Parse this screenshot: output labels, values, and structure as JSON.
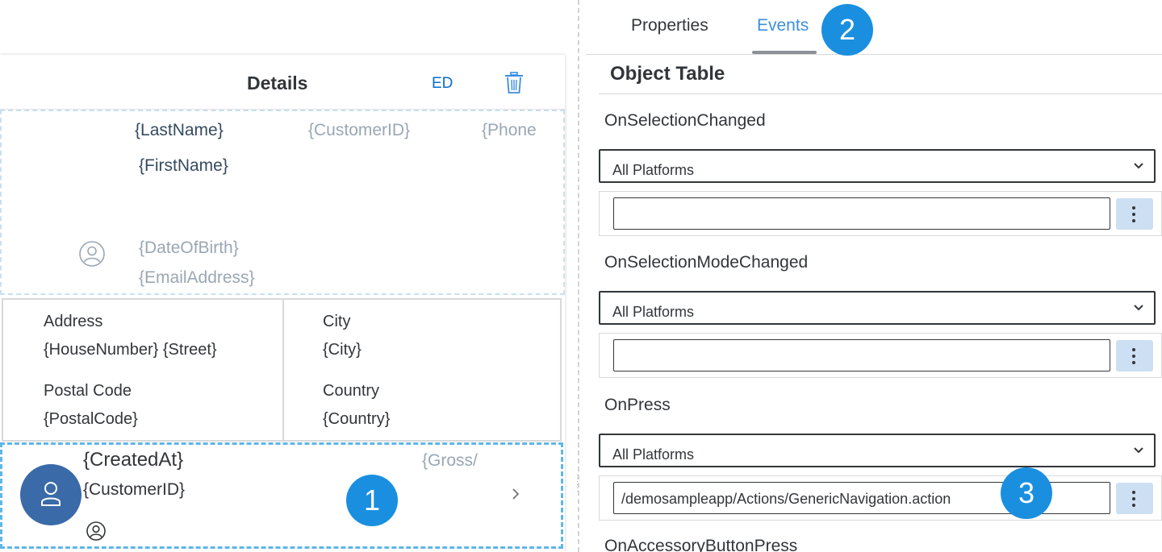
{
  "details": {
    "title": "Details",
    "ed_label": "ED"
  },
  "profile": {
    "last_name": "{LastName}",
    "customer_id": "{CustomerID}",
    "phone": "{Phone",
    "first_name": "{FirstName}",
    "date_of_birth": "{DateOfBirth}",
    "email": "{EmailAddress}"
  },
  "key_values": {
    "address_label": "Address",
    "address_value": "{HouseNumber} {Street}",
    "city_label": "City",
    "city_value": "{City}",
    "postal_label": "Postal Code",
    "postal_value": "{PostalCode}",
    "country_label": "Country",
    "country_value": "{Country}"
  },
  "object_row": {
    "title": "{CreatedAt}",
    "subtitle": "{CustomerID}",
    "status": "{Gross/"
  },
  "badges": [
    "1",
    "2",
    "3"
  ],
  "tabs": {
    "properties": "Properties",
    "events": "Events"
  },
  "panel": {
    "section_title": "Object Table",
    "events": [
      {
        "label": "OnSelectionChanged",
        "platform": "All Platforms",
        "value": ""
      },
      {
        "label": "OnSelectionModeChanged",
        "platform": "All Platforms",
        "value": ""
      },
      {
        "label": "OnPress",
        "platform": "All Platforms",
        "value": "/demosampleapp/Actions/GenericNavigation.action"
      },
      {
        "label": "OnAccessoryButtonPress"
      }
    ]
  },
  "colors": {
    "accent": "#0a6ed1",
    "badge": "#1a8fe0",
    "avatar": "#3a6aa8",
    "selection": "#5fb6ea"
  }
}
